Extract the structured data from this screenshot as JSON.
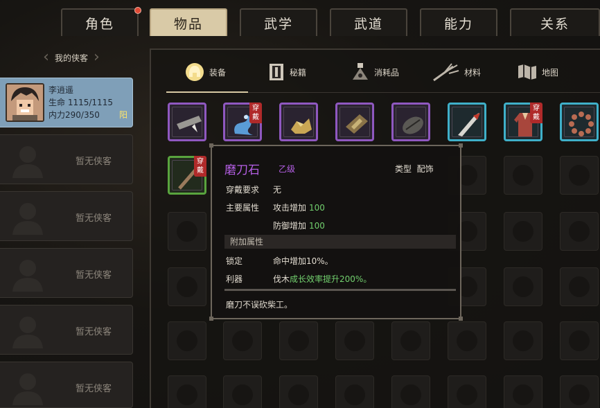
{
  "top_tabs": [
    {
      "label": "角色"
    },
    {
      "label": "物品"
    },
    {
      "label": "武学"
    },
    {
      "label": "武道"
    },
    {
      "label": "能力"
    },
    {
      "label": "关系"
    }
  ],
  "sidebar": {
    "title": "我的侠客",
    "hero": {
      "name": "李逍遥",
      "hp_label": "生命",
      "hp": "1115/1115",
      "mp_label": "内力",
      "mp": "290/350",
      "trait": "阳"
    },
    "empty_label": "暂无侠客"
  },
  "sub_tabs": [
    {
      "label": "装备"
    },
    {
      "label": "秘籍"
    },
    {
      "label": "消耗品"
    },
    {
      "label": "材料"
    },
    {
      "label": "地图"
    }
  ],
  "equipped_badge": "穿戴",
  "tooltip": {
    "name": "磨刀石",
    "grade": "乙级",
    "type_label": "类型",
    "type_value": "配饰",
    "req_label": "穿戴要求",
    "req_value": "无",
    "main_label": "主要属性",
    "main1_name": "攻击增加",
    "main1_value": "100",
    "main2_name": "防御增加",
    "main2_value": "100",
    "extra_header": "附加属性",
    "extra1_name": "锁定",
    "extra1_value": "命中增加10%。",
    "extra2_name": "利器",
    "extra2_pre": "伐木",
    "extra2_value": "成长效率提升200%。",
    "description": "磨刀不误砍柴工。"
  },
  "colors": {
    "active_tab": "#d9caa7",
    "selected_slot": "#7f9fb8",
    "purple_rarity": "#8f58c0",
    "cyan_rarity": "#3fb0c9",
    "green_rarity": "#59a43e",
    "value_green": "#72d06e",
    "name_purple": "#b55fe5"
  }
}
